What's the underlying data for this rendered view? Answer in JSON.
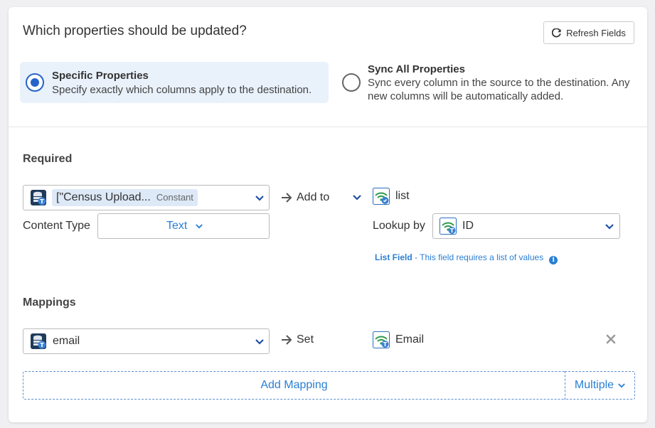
{
  "header": {
    "title": "Which properties should be updated?",
    "refresh_label": "Refresh Fields"
  },
  "options": {
    "specific": {
      "title": "Specific Properties",
      "description": "Specify exactly which columns apply to the destination.",
      "selected": true
    },
    "all": {
      "title": "Sync All Properties",
      "description": "Sync every column in the source to the destination. Any new columns will be automatically added.",
      "selected": false
    }
  },
  "required": {
    "label": "Required",
    "source": {
      "value": "[\"Census Upload...",
      "badge": "Constant"
    },
    "operation": "Add to",
    "target": "list",
    "content_type_label": "Content Type",
    "content_type_value": "Text",
    "lookup_label": "Lookup by",
    "lookup_value": "ID",
    "hint_title": "List Field",
    "hint_text": " - This field requires a list of values"
  },
  "mappings": {
    "label": "Mappings",
    "rows": [
      {
        "source": "email",
        "operation": "Set",
        "target": "Email"
      }
    ],
    "add_label": "Add Mapping",
    "multiple_label": "Multiple"
  },
  "icons": {
    "refresh": "refresh-icon",
    "source": "database-text-icon",
    "target": "wifi-list-icon",
    "arrow": "arrow-right-icon",
    "chevron": "chevron-down-icon",
    "info": "info-icon",
    "remove": "close-icon"
  },
  "colors": {
    "accent": "#2563c9",
    "link": "#2a7fd4",
    "selected_bg": "#e9f1fb"
  }
}
